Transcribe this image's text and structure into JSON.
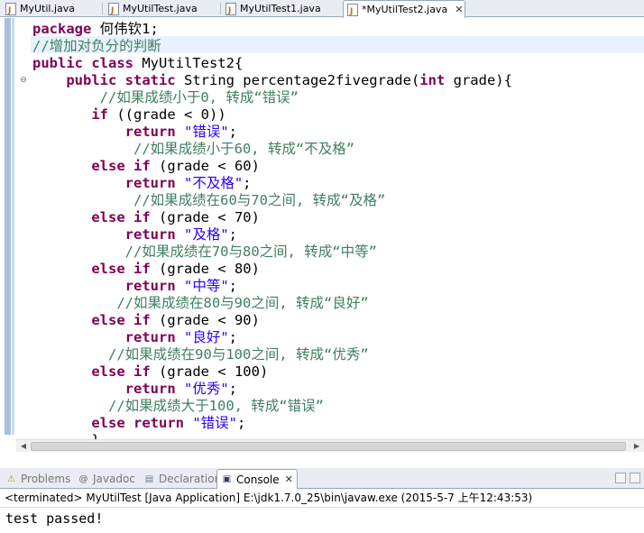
{
  "editor_tabs": [
    {
      "label": "MyUtil.java",
      "active": false
    },
    {
      "label": "MyUtilTest.java",
      "active": false
    },
    {
      "label": "MyUtilTest1.java",
      "active": false
    },
    {
      "label": "*MyUtilTest2.java",
      "active": true
    }
  ],
  "close_glyph": "✕",
  "code_lines": [
    {
      "indent": "",
      "parts": [
        {
          "t": "kw",
          "v": "package"
        },
        {
          "t": "pl",
          "v": " 何伟钦1;"
        }
      ]
    },
    {
      "indent": "",
      "parts": [
        {
          "t": "cm",
          "v": "//增加对负分的判断"
        }
      ]
    },
    {
      "indent": "",
      "parts": [
        {
          "t": "kw",
          "v": "public class"
        },
        {
          "t": "pl",
          "v": " MyUtilTest2{"
        }
      ]
    },
    {
      "indent": "    ",
      "parts": [
        {
          "t": "kw",
          "v": "public static"
        },
        {
          "t": "pl",
          "v": " String percentage2fivegrade("
        },
        {
          "t": "kw",
          "v": "int"
        },
        {
          "t": "pl",
          "v": " grade){"
        }
      ]
    },
    {
      "indent": "        ",
      "parts": [
        {
          "t": "cm",
          "v": "//如果成绩小于0, 转成“错误”"
        }
      ]
    },
    {
      "indent": "       ",
      "parts": [
        {
          "t": "kw",
          "v": "if"
        },
        {
          "t": "pl",
          "v": " ((grade < 0))"
        }
      ]
    },
    {
      "indent": "           ",
      "parts": [
        {
          "t": "kw",
          "v": "return"
        },
        {
          "t": "st",
          "v": " \"错误\""
        },
        {
          "t": "pl",
          "v": ";"
        }
      ]
    },
    {
      "indent": "            ",
      "parts": [
        {
          "t": "cm",
          "v": "//如果成绩小于60, 转成“不及格”"
        }
      ]
    },
    {
      "indent": "       ",
      "parts": [
        {
          "t": "kw",
          "v": "else if"
        },
        {
          "t": "pl",
          "v": " (grade < 60)"
        }
      ]
    },
    {
      "indent": "           ",
      "parts": [
        {
          "t": "kw",
          "v": "return"
        },
        {
          "t": "st",
          "v": " \"不及格\""
        },
        {
          "t": "pl",
          "v": ";"
        }
      ]
    },
    {
      "indent": "            ",
      "parts": [
        {
          "t": "cm",
          "v": "//如果成绩在60与70之间, 转成“及格”"
        }
      ]
    },
    {
      "indent": "       ",
      "parts": [
        {
          "t": "kw",
          "v": "else if"
        },
        {
          "t": "pl",
          "v": " (grade < 70)"
        }
      ]
    },
    {
      "indent": "           ",
      "parts": [
        {
          "t": "kw",
          "v": "return"
        },
        {
          "t": "st",
          "v": " \"及格\""
        },
        {
          "t": "pl",
          "v": ";"
        }
      ]
    },
    {
      "indent": "           ",
      "parts": [
        {
          "t": "cm",
          "v": "//如果成绩在70与80之间, 转成“中等”"
        }
      ]
    },
    {
      "indent": "       ",
      "parts": [
        {
          "t": "kw",
          "v": "else if"
        },
        {
          "t": "pl",
          "v": " (grade < 80)"
        }
      ]
    },
    {
      "indent": "           ",
      "parts": [
        {
          "t": "kw",
          "v": "return"
        },
        {
          "t": "st",
          "v": " \"中等\""
        },
        {
          "t": "pl",
          "v": ";"
        }
      ]
    },
    {
      "indent": "          ",
      "parts": [
        {
          "t": "cm",
          "v": "//如果成绩在80与90之间, 转成“良好”"
        }
      ]
    },
    {
      "indent": "       ",
      "parts": [
        {
          "t": "kw",
          "v": "else if"
        },
        {
          "t": "pl",
          "v": " (grade < 90)"
        }
      ]
    },
    {
      "indent": "           ",
      "parts": [
        {
          "t": "kw",
          "v": "return"
        },
        {
          "t": "st",
          "v": " \"良好\""
        },
        {
          "t": "pl",
          "v": ";"
        }
      ]
    },
    {
      "indent": "         ",
      "parts": [
        {
          "t": "cm",
          "v": "//如果成绩在90与100之间, 转成“优秀”"
        }
      ]
    },
    {
      "indent": "       ",
      "parts": [
        {
          "t": "kw",
          "v": "else if"
        },
        {
          "t": "pl",
          "v": " (grade < 100)"
        }
      ]
    },
    {
      "indent": "           ",
      "parts": [
        {
          "t": "kw",
          "v": "return"
        },
        {
          "t": "st",
          "v": " \"优秀\""
        },
        {
          "t": "pl",
          "v": ";"
        }
      ]
    },
    {
      "indent": "         ",
      "parts": [
        {
          "t": "cm",
          "v": "//如果成绩大于100, 转成“错误”"
        }
      ]
    },
    {
      "indent": "       ",
      "parts": [
        {
          "t": "kw",
          "v": "else return"
        },
        {
          "t": "st",
          "v": " \"错误\""
        },
        {
          "t": "pl",
          "v": ";"
        }
      ]
    },
    {
      "indent": "       ",
      "parts": [
        {
          "t": "pl",
          "v": "}"
        }
      ]
    }
  ],
  "view_tabs": [
    {
      "label": "Problems",
      "icon": "problems-icon",
      "glyph": "⚠",
      "active": false
    },
    {
      "label": "Javadoc",
      "icon": "javadoc-icon",
      "glyph": "@",
      "active": false
    },
    {
      "label": "Declaration",
      "icon": "declaration-icon",
      "glyph": "▤",
      "active": false
    },
    {
      "label": "Console",
      "icon": "console-icon",
      "glyph": "▣",
      "active": true
    }
  ],
  "console": {
    "status": "<terminated> MyUtilTest [Java Application] E:\\jdk1.7.0_25\\bin\\javaw.exe (2015-5-7 上午12:43:53)",
    "output": "test passed!"
  },
  "colors": {
    "keyword": "#7f0055",
    "comment": "#3f7f5f",
    "string": "#2a00ff"
  }
}
